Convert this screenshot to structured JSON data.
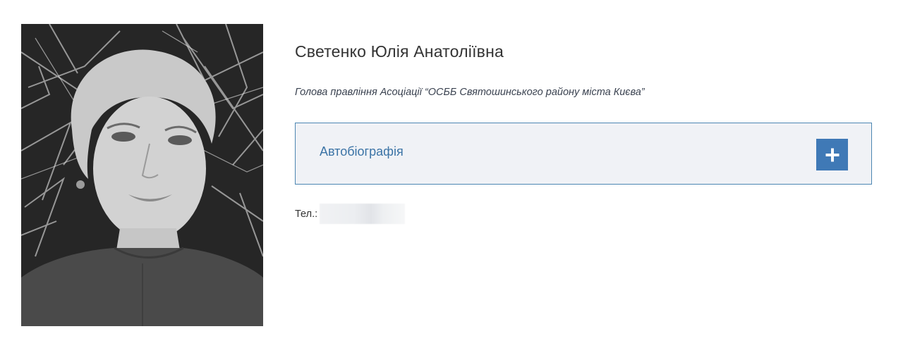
{
  "person": {
    "name": "Светенко Юлія Анатоліївна",
    "position": "Голова правління Асоціації “ОСББ Святошинського району міста Києва”"
  },
  "accordion": {
    "title": "Автобіографія",
    "toggle_icon": "plus-icon"
  },
  "contact": {
    "phone_label": "Тел.:"
  },
  "photo": {
    "icon": "portrait-photo",
    "style": "black-and-white"
  }
}
